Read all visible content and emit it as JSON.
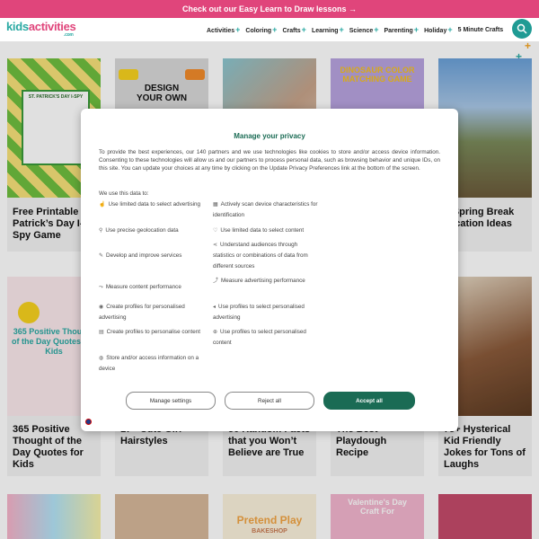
{
  "promo": {
    "text": "Check out our Easy Learn to Draw lessons →"
  },
  "logo": {
    "part1": "kids",
    "part2": "activities",
    "suffix": ".com"
  },
  "nav": [
    {
      "label": "Activities"
    },
    {
      "label": "Coloring"
    },
    {
      "label": "Crafts"
    },
    {
      "label": "Learning"
    },
    {
      "label": "Science"
    },
    {
      "label": "Parenting"
    },
    {
      "label": "Holiday"
    },
    {
      "label": "5 Minute Crafts"
    }
  ],
  "nav_plus": "+",
  "cards": [
    {
      "title": "Free Printable Patrick’s Day I-Spy Game",
      "thumb_text": "ST. PATRICK'S DAY I-SPY"
    },
    {
      "title": "",
      "thumb_text": "DESIGN YOUR OWN"
    },
    {
      "title": "",
      "thumb_text": ""
    },
    {
      "title": "",
      "thumb_text": "DINOSAUR COLOR MATCHING GAME"
    },
    {
      "title": "n Spring Break aycation Ideas",
      "thumb_text": ""
    },
    {
      "title": "365 Positive Thought of the Day Quotes for Kids",
      "thumb_text": "365 Positive Thought of the Day Quotes For Kids"
    },
    {
      "title": "17+ Cute Girl Hairstyles",
      "thumb_text": ""
    },
    {
      "title": "50 Random Facts that you Won’t Believe are True",
      "thumb_text": ""
    },
    {
      "title": "The Best Playdough Recipe",
      "thumb_text": ""
    },
    {
      "title": "75+ Hysterical Kid Friendly Jokes for Tons of Laughs",
      "thumb_text": ""
    }
  ],
  "bottom_thumbs": {
    "pretend": "Pretend Play",
    "bakeshop": "BAKESHOP",
    "valentine": "Valentine's Day Craft For"
  },
  "consent": {
    "title": "Manage your privacy",
    "intro": "To provide the best experiences, our 140 partners and we use technologies like cookies to store and/or access device information. Consenting to these technologies will allow us and our partners to process personal data, such as browsing behavior and unique IDs, on this site. You can update your choices at any time by clicking on the Update Privacy Preferences link at the bottom of the screen.",
    "uses_label": "We use this data to:",
    "left_purposes": [
      "Use limited data to select advertising",
      "Use precise geolocation data",
      "Develop and improve services",
      "Measure content performance",
      "Create profiles for personalised advertising",
      "Create profiles to personalise content",
      "Store and/or access information on a device"
    ],
    "right_purposes": [
      "Actively scan device characteristics for identification",
      "Use limited data to select content",
      "Understand audiences through statistics or combinations of data from different sources",
      "Measure advertising performance",
      "Use profiles to select personalised advertising",
      "Use profiles to select personalised content"
    ],
    "manage_label": "Manage settings",
    "reject_label": "Reject all",
    "accept_label": "Accept all"
  },
  "colors": {
    "brand_teal": "#2aa9a3",
    "brand_pink": "#e0457b",
    "accept_green": "#1a6b54"
  }
}
